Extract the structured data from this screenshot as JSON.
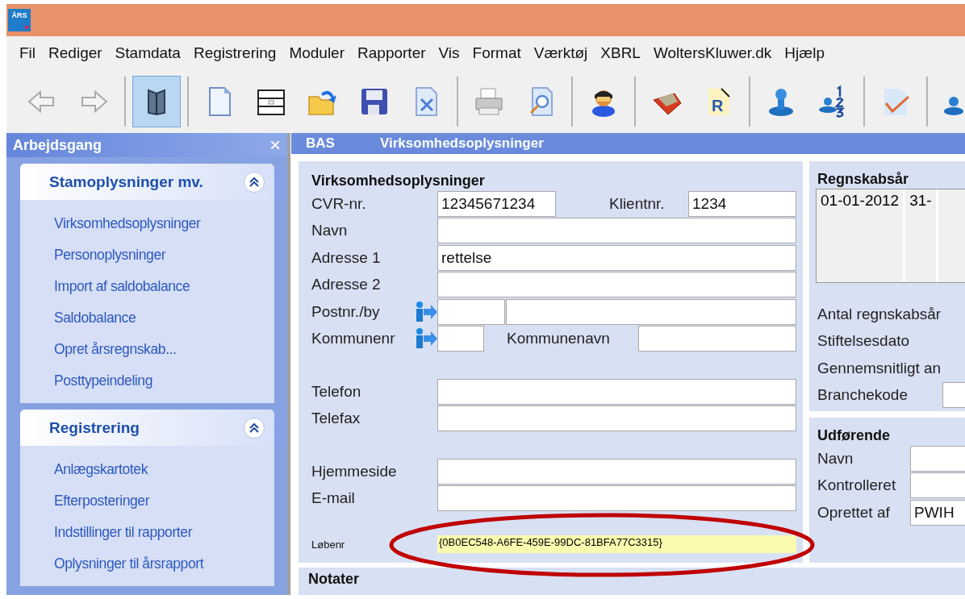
{
  "title_bar": {
    "app_icon_text": "ÅRS"
  },
  "menu": [
    "Fil",
    "Rediger",
    "Stamdata",
    "Registrering",
    "Moduler",
    "Rapporter",
    "Vis",
    "Format",
    "Værktøj",
    "XBRL",
    "WoltersKluwer.dk",
    "Hjælp"
  ],
  "toolbar": {
    "groups": [
      {
        "buttons": [
          {
            "selected": false
          },
          {
            "selected": false
          }
        ]
      },
      {
        "buttons": [
          {
            "selected": true
          }
        ]
      },
      {
        "buttons": [
          {
            "selected": false
          },
          {
            "selected": false
          },
          {
            "selected": false
          },
          {
            "selected": false
          },
          {
            "selected": false
          }
        ]
      },
      {
        "buttons": [
          {
            "selected": false
          },
          {
            "selected": false
          }
        ]
      },
      {
        "buttons": [
          {
            "selected": false
          }
        ]
      },
      {
        "buttons": [
          {
            "selected": false
          },
          {
            "selected": false,
            "icon_text": "R"
          }
        ]
      },
      {
        "buttons": [
          {
            "selected": false
          },
          {
            "selected": false
          }
        ]
      },
      {
        "buttons": [
          {
            "selected": false
          }
        ]
      },
      {
        "buttons": [
          {
            "selected": false
          }
        ]
      }
    ]
  },
  "sidebar": {
    "title": "Arbejdsgang",
    "close": "×",
    "groups": [
      {
        "title": "Stamoplysninger mv.",
        "expanded": true,
        "items": [
          "Virksomhedsoplysninger",
          "Personoplysninger",
          "Import af saldobalance",
          "Saldobalance",
          "Opret årsregnskab...",
          "Posttypeindeling"
        ]
      },
      {
        "title": "Registrering",
        "expanded": true,
        "items": [
          "Anlægskartotek",
          "Efterposteringer",
          "Indstillinger til rapporter",
          "Oplysninger til årsrapport"
        ]
      }
    ]
  },
  "document": {
    "module": "BAS",
    "title": "Virksomhedsoplysninger",
    "company": {
      "title": "Virksomhedsoplysninger",
      "sections": [
        [
          {
            "kind": "pair",
            "label": "CVR-nr.",
            "value": "12345671234",
            "label_2": "Klientnr.",
            "value_2": "1234"
          },
          {
            "kind": "text",
            "label": "Navn"
          },
          {
            "kind": "text",
            "label": "Adresse 1",
            "value": "rettelse"
          },
          {
            "kind": "text",
            "label": "Adresse 2"
          },
          {
            "kind": "split",
            "label": "Postnr./by",
            "info": true
          },
          {
            "kind": "code",
            "label": "Kommunenr",
            "info": true,
            "label_2": "Kommunenavn"
          }
        ],
        [
          {
            "kind": "text",
            "label": "Telefon"
          },
          {
            "kind": "text",
            "label": "Telefax"
          }
        ],
        [
          {
            "kind": "text",
            "label": "Hjemmeside"
          },
          {
            "kind": "text",
            "label": "E-mail"
          }
        ]
      ],
      "serial": {
        "label": "Løbenr",
        "value": "{0B0EC548-A6FE-459E-99DC-81BFA77C3315}"
      }
    },
    "fiscal_years": {
      "title": "Regnskabsår",
      "rows": [
        {
          "start": "01-01-2012",
          "end": "31-"
        }
      ],
      "fields": [
        {
          "kind": "label",
          "label": "Antal regnskabsår"
        },
        {
          "kind": "label",
          "label": "Stiftelsesdato"
        },
        {
          "kind": "label",
          "label": "Gennemsnitligt an"
        },
        {
          "kind": "input",
          "label": "Branchekode"
        }
      ]
    },
    "executor": {
      "title": "Udførende",
      "fields": [
        {
          "label": "Navn"
        },
        {
          "label": "Kontrolleret"
        },
        {
          "label": "Oprettet af",
          "value": "PWIH"
        }
      ]
    },
    "notes": {
      "title": "Notater"
    }
  }
}
